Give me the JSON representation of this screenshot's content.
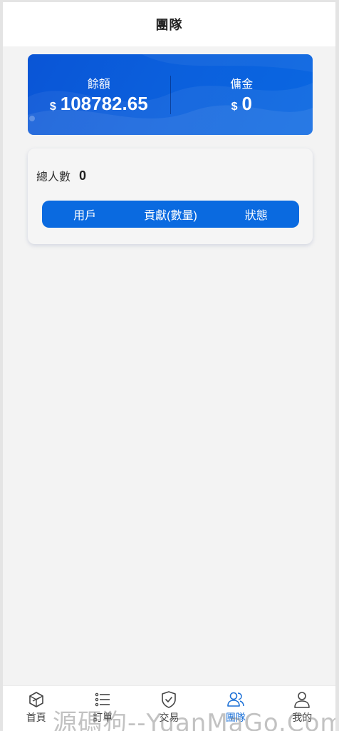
{
  "header": {
    "title": "團隊"
  },
  "balance_card": {
    "balance_label": "餘額",
    "balance_currency": "$",
    "balance_value": "108782.65",
    "commission_label": "傭金",
    "commission_currency": "$",
    "commission_value": "0"
  },
  "team": {
    "total_label": "總人數",
    "total_value": "0",
    "columns": [
      "用戶",
      "貢獻(數量)",
      "狀態"
    ]
  },
  "tabbar": {
    "items": [
      {
        "label": "首頁",
        "icon": "home-cube-icon",
        "active": false
      },
      {
        "label": "訂單",
        "icon": "list-icon",
        "active": false
      },
      {
        "label": "交易",
        "icon": "shield-check-icon",
        "active": false
      },
      {
        "label": "團隊",
        "icon": "team-icon",
        "active": true
      },
      {
        "label": "我的",
        "icon": "user-icon",
        "active": false
      }
    ]
  },
  "colors": {
    "primary": "#0a6ae0",
    "card_blue": "#0b5fdc",
    "active_tab": "#1a6fd6",
    "background": "#f3f3f3"
  },
  "watermark": "源碼狗--YuanMaGo.Com"
}
